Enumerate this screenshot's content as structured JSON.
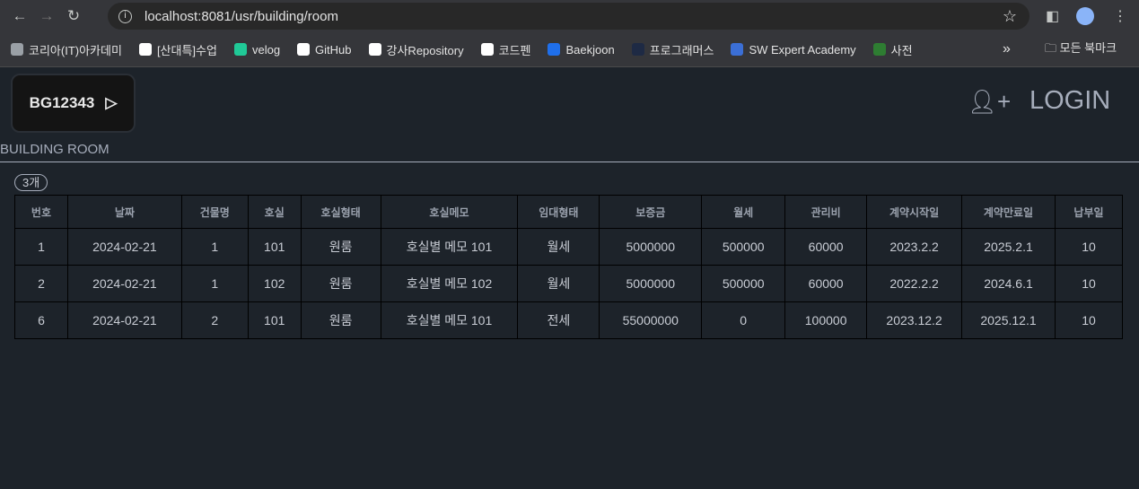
{
  "browser": {
    "url": "localhost:8081/usr/building/room",
    "bookmarks": [
      "코리아(IT)아카데미",
      "[산대특]수업",
      "velog",
      "GitHub",
      "강사Repository",
      "코드펜",
      "Baekjoon",
      "프로그래머스",
      "SW Expert Academy",
      "사전"
    ],
    "more": "»",
    "all_bookmarks": "모든 북마크"
  },
  "header": {
    "logo": "BG12343",
    "login": "LOGIN"
  },
  "page": {
    "title": "BUILDING ROOM",
    "count": "3개"
  },
  "table": {
    "columns": [
      "번호",
      "날짜",
      "건물명",
      "호실",
      "호실형태",
      "호실메모",
      "임대형태",
      "보증금",
      "월세",
      "관리비",
      "계약시작일",
      "계약만료일",
      "납부일"
    ],
    "rows": [
      [
        "1",
        "2024-02-21",
        "1",
        "101",
        "원룸",
        "호실별 메모 101",
        "월세",
        "5000000",
        "500000",
        "60000",
        "2023.2.2",
        "2025.2.1",
        "10"
      ],
      [
        "2",
        "2024-02-21",
        "1",
        "102",
        "원룸",
        "호실별 메모 102",
        "월세",
        "5000000",
        "500000",
        "60000",
        "2022.2.2",
        "2024.6.1",
        "10"
      ],
      [
        "6",
        "2024-02-21",
        "2",
        "101",
        "원룸",
        "호실별 메모 101",
        "전세",
        "55000000",
        "0",
        "100000",
        "2023.12.2",
        "2025.12.1",
        "10"
      ]
    ]
  }
}
